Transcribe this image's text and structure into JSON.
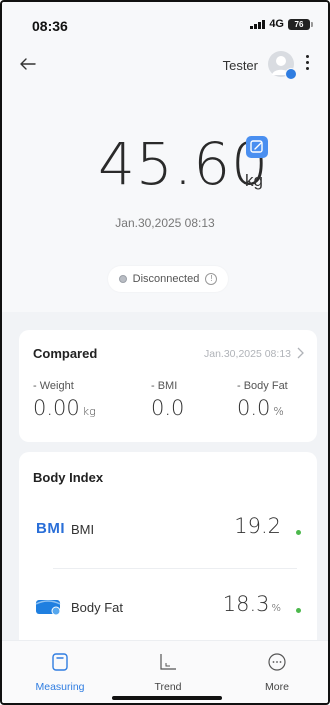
{
  "status_bar": {
    "time": "08:36",
    "network": "4G",
    "battery": "76"
  },
  "header": {
    "back_icon": "arrow-left-icon",
    "user_name": "Tester",
    "avatar_icon": "user-avatar-icon",
    "more_icon": "vertical-dots-icon"
  },
  "measurement": {
    "weight": "45.60",
    "unit": "kg",
    "datetime": "Jan.30,2025 08:13",
    "edit_icon": "edit-icon",
    "connection_status": "Disconnected",
    "accent_color": "#4a8ff0"
  },
  "compared": {
    "title": "Compared",
    "date": "Jan.30,2025 08:13",
    "metrics": [
      {
        "label": "- Weight",
        "value": "0.00",
        "unit": "kg"
      },
      {
        "label": "- BMI",
        "value": "0.0",
        "unit": ""
      },
      {
        "label": "- Body Fat",
        "value": "0.0",
        "unit": "%"
      }
    ]
  },
  "body_index": {
    "title": "Body Index",
    "items": [
      {
        "logo": "BMI",
        "label": "BMI",
        "value": "19.2",
        "unit": "",
        "status_color": "#4cb84c"
      },
      {
        "label": "Body Fat",
        "value": "18.3",
        "unit": "%",
        "status_color": "#4cb84c",
        "icon": "body-fat-scale-icon"
      }
    ]
  },
  "bottom_nav": {
    "items": [
      {
        "label": "Measuring",
        "icon": "scale-icon",
        "active": true
      },
      {
        "label": "Trend",
        "icon": "trend-chart-icon",
        "active": false
      },
      {
        "label": "More",
        "icon": "more-circle-icon",
        "active": false
      }
    ],
    "active_color": "#2f7de1"
  }
}
